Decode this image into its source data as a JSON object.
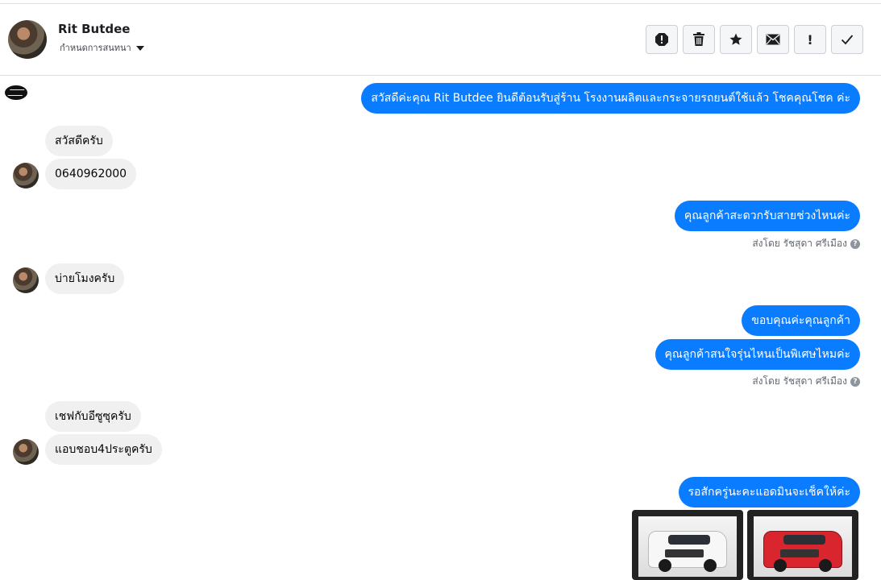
{
  "header": {
    "contact_name": "Rit Butdee",
    "assign_label": "กำหนดการสนทนา",
    "actions": [
      "spam-icon",
      "trash-icon",
      "star-icon",
      "mail-icon",
      "!",
      "check-icon"
    ]
  },
  "messages": [
    {
      "dir": "out",
      "text": "สวัสดีค่ะคุณ Rit Butdee ยินดีต้อนรับสู่ร้าน โรงงานผลิตและกระจายรถยนต์ใช้แล้ว โชคคุณโชค ค่ะ"
    },
    {
      "dir": "in",
      "text": "สวัสดีครับ"
    },
    {
      "dir": "in",
      "text": "0640962000"
    },
    {
      "dir": "out",
      "text": "คุณลูกค้าสะดวกรับสายช่วงไหนค่ะ"
    },
    {
      "dir": "in",
      "text": "บ่ายโมงครับ"
    },
    {
      "dir": "out",
      "text": "ขอบคุณค่ะคุณลูกค้า"
    },
    {
      "dir": "out",
      "text": "คุณลูกค้าสนใจรุ่นไหนเป็นพิเศษไหมค่ะ"
    },
    {
      "dir": "in",
      "text": "เชฟกับอีซูซุครับ"
    },
    {
      "dir": "in",
      "text": "แอบชอบ4ประตูครับ"
    },
    {
      "dir": "out",
      "text": "รอสักครู่นะคะแอดมินจะเช็คให้ค่ะ"
    }
  ],
  "sent_by": [
    "ส่งโดย รัชสุดา ศรีเมือง",
    "ส่งโดย รัชสุดา ศรีเมือง"
  ],
  "images": [
    {
      "alt": "white pickup truck photo"
    },
    {
      "alt": "red pickup truck photo"
    }
  ],
  "colors": {
    "outgoing": "#0a7cff",
    "incoming": "#f0f0f0"
  }
}
